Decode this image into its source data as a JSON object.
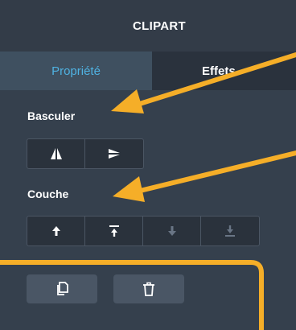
{
  "header": {
    "title": "CLIPART"
  },
  "tabs": [
    {
      "label": "Propriété",
      "active": true
    },
    {
      "label": "Effets",
      "active": false
    }
  ],
  "basculer": {
    "label": "Basculer",
    "buttons": [
      "flip-horizontal-icon",
      "flip-vertical-icon"
    ]
  },
  "couche": {
    "label": "Couche",
    "buttons": [
      "arrow-up-icon",
      "bring-to-front-icon",
      "arrow-down-icon",
      "send-to-back-icon"
    ]
  },
  "actions": {
    "buttons": [
      "duplicate-icon",
      "trash-icon"
    ]
  },
  "colors": {
    "panel": "#35404d",
    "header": "#333c48",
    "active_tab": "#3f5060",
    "active_tab_text": "#4fb2e2",
    "annotation": "#f5ae28"
  }
}
